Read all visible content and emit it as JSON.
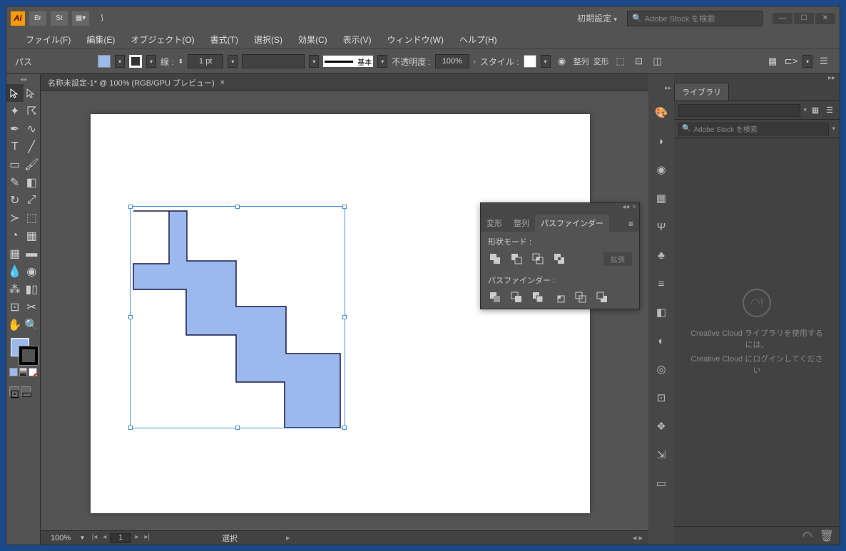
{
  "titlebar": {
    "workspace": "初期設定",
    "search_placeholder": "Adobe Stock を検索"
  },
  "menu": [
    "ファイル(F)",
    "編集(E)",
    "オブジェクト(O)",
    "書式(T)",
    "選択(S)",
    "効果(C)",
    "表示(V)",
    "ウィンドウ(W)",
    "ヘルプ(H)"
  ],
  "controlbar": {
    "selection_label": "パス",
    "stroke_label": "線 :",
    "stroke_weight": "1 pt",
    "stroke_style": "基本",
    "opacity_label": "不透明度 :",
    "opacity_value": "100%",
    "style_label": "スタイル :",
    "align_label": "整列",
    "transform_label": "変形"
  },
  "document": {
    "tab_title": "名称未設定-1* @ 100% (RGB/GPU プレビュー)",
    "zoom": "100%",
    "page": "1",
    "status": "選択"
  },
  "pathfinder_panel": {
    "tabs": [
      "変形",
      "整列",
      "パスファインダー"
    ],
    "shape_mode_label": "形状モード :",
    "expand_label": "拡張",
    "pathfinder_label": "パスファインダー :"
  },
  "library_panel": {
    "tab": "ライブラリ",
    "search_placeholder": "Adobe Stock を検索",
    "message_line1": "Creative Cloud ライブラリを使用するには、",
    "message_line2": "Creative Cloud にログインしてください"
  },
  "colors": {
    "fill": "#9cb9ee",
    "selection": "#4a90d9"
  }
}
